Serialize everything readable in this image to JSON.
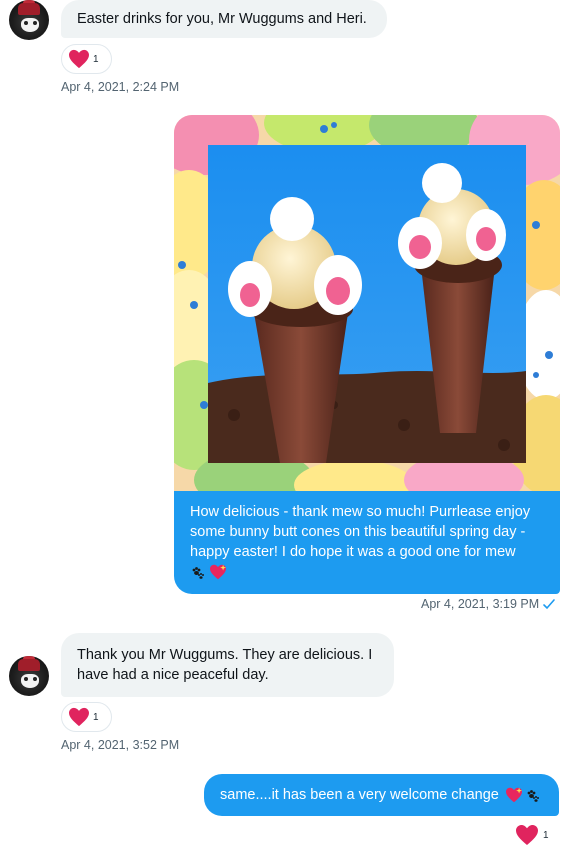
{
  "messages": [
    {
      "sender": "other",
      "text": "Easter drinks for you, Mr Wuggums and Heri.",
      "reaction_count": "1",
      "timestamp": "Apr 4, 2021, 2:24 PM"
    },
    {
      "sender": "me",
      "image_alt": "Ice cream cones with bunny butts on an Easter egg background",
      "text": "How delicious - thank mew so much!  Purrlease enjoy some bunny butt cones on this beautiful spring day - happy easter! I do hope it was a good one for mew",
      "timestamp": "Apr 4, 2021, 3:19 PM"
    },
    {
      "sender": "other",
      "text_line1": "Thank you Mr Wuggums. They are delicious.  I",
      "text_line2": "have had a nice peaceful day.",
      "reaction_count": "1",
      "timestamp": "Apr 4, 2021, 3:52 PM"
    },
    {
      "sender": "me",
      "text": "same....it has been a very welcome change",
      "reaction_count": "1"
    }
  ],
  "colors": {
    "outgoing_bubble": "#1d9bf0",
    "incoming_bubble": "#eff3f4",
    "heart": "#e0245e",
    "timestamp": "#536471"
  },
  "icons": {
    "reaction": "heart-icon",
    "sent_status": "check-icon",
    "emoji_paws": "paw-prints-icon",
    "emoji_heart": "sparkling-heart-icon"
  }
}
